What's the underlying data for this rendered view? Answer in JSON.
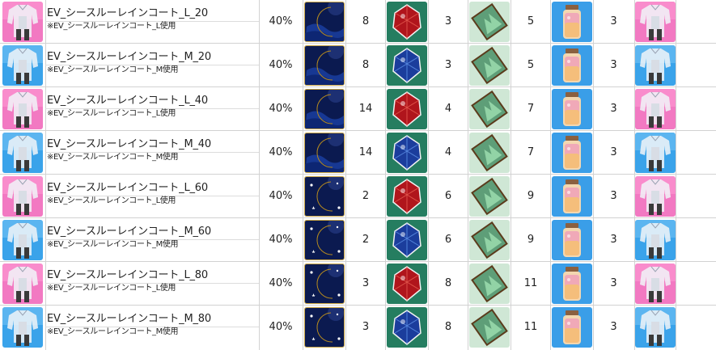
{
  "rows": [
    {
      "variant": "L",
      "name": "EV_シースルーレインコート_L_20",
      "sub": "※EV_シースルーレインコート_L使用",
      "rate": "40%",
      "moon_type": "moon-a",
      "gem_type": "red",
      "q1": "8",
      "q2": "3",
      "q3": "5",
      "q4": "3"
    },
    {
      "variant": "M",
      "name": "EV_シースルーレインコート_M_20",
      "sub": "※EV_シースルーレインコート_M使用",
      "rate": "40%",
      "moon_type": "moon-a",
      "gem_type": "blue",
      "q1": "8",
      "q2": "3",
      "q3": "5",
      "q4": "3"
    },
    {
      "variant": "L",
      "name": "EV_シースルーレインコート_L_40",
      "sub": "※EV_シースルーレインコート_L使用",
      "rate": "40%",
      "moon_type": "moon-a",
      "gem_type": "red",
      "q1": "14",
      "q2": "4",
      "q3": "7",
      "q4": "3"
    },
    {
      "variant": "M",
      "name": "EV_シースルーレインコート_M_40",
      "sub": "※EV_シースルーレインコート_M使用",
      "rate": "40%",
      "moon_type": "moon-a",
      "gem_type": "blue",
      "q1": "14",
      "q2": "4",
      "q3": "7",
      "q4": "3"
    },
    {
      "variant": "L",
      "name": "EV_シースルーレインコート_L_60",
      "sub": "※EV_シースルーレインコート_L使用",
      "rate": "40%",
      "moon_type": "moon-b",
      "gem_type": "red",
      "q1": "2",
      "q2": "6",
      "q3": "9",
      "q4": "3"
    },
    {
      "variant": "M",
      "name": "EV_シースルーレインコート_M_60",
      "sub": "※EV_シースルーレインコート_M使用",
      "rate": "40%",
      "moon_type": "moon-b",
      "gem_type": "blue",
      "q1": "2",
      "q2": "6",
      "q3": "9",
      "q4": "3"
    },
    {
      "variant": "L",
      "name": "EV_シースルーレインコート_L_80",
      "sub": "※EV_シースルーレインコート_L使用",
      "rate": "40%",
      "moon_type": "moon-b",
      "gem_type": "red",
      "q1": "3",
      "q2": "8",
      "q3": "11",
      "q4": "3"
    },
    {
      "variant": "M",
      "name": "EV_シースルーレインコート_M_80",
      "sub": "※EV_シースルーレインコート_M使用",
      "rate": "40%",
      "moon_type": "moon-b",
      "gem_type": "blue",
      "q1": "3",
      "q2": "8",
      "q3": "11",
      "q4": "3"
    }
  ],
  "colors": {
    "pink_bg": "#f279c2",
    "blue_bg": "#3aa3ea",
    "moon_bg": "#0b1a50",
    "moon_gold": "#f3c64a",
    "gem_red": "#b0151c",
    "gem_blue": "#1b3d9c",
    "card_green": "#5e9e78",
    "bottle_bg": "#3a9ee8",
    "grid": "#d2d2d2"
  }
}
